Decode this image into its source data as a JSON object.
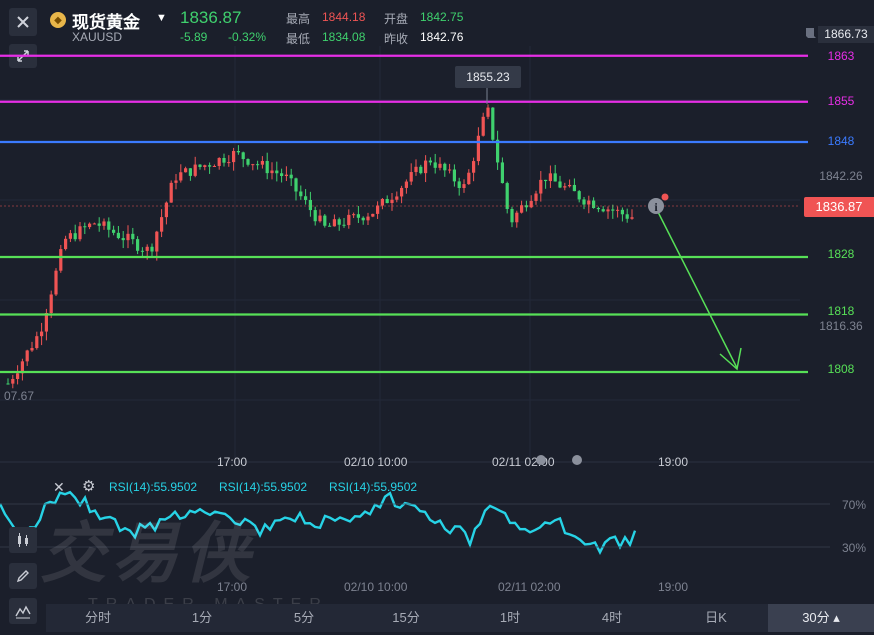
{
  "header": {
    "name": "现货黄金",
    "code": "XAUUSD",
    "price": "1836.87",
    "change": "-5.89",
    "change_pct": "-0.32%",
    "high_label": "最高",
    "high_value": "1844.18",
    "open_label": "开盘",
    "open_value": "1842.75",
    "low_label": "最低",
    "low_value": "1834.08",
    "prev_close_label": "昨收",
    "prev_close_value": "1842.76"
  },
  "price_axis": {
    "top_value": "1866.73",
    "mid_value": "1842.26",
    "current_price": "1836.87",
    "left_clip": "07.67",
    "lower_value": "1816.36"
  },
  "levels": [
    {
      "value": "1863",
      "color": "#e62ee6"
    },
    {
      "value": "1855",
      "color": "#e62ee6"
    },
    {
      "value": "1848",
      "color": "#3b7bff"
    },
    {
      "value": "1828",
      "color": "#57e057"
    },
    {
      "value": "1818",
      "color": "#57e057"
    },
    {
      "value": "1808",
      "color": "#57e057"
    }
  ],
  "tooltip": "1855.23",
  "time_axis": [
    "17:00",
    "02/10 10:00",
    "02/11 02:00",
    "19:00"
  ],
  "rsi": {
    "labels": [
      "RSI(14):55.9502",
      "RSI(14):55.9502",
      "RSI(14):55.9502"
    ],
    "levels": [
      "70%",
      "30%"
    ],
    "color": "#27d3e6"
  },
  "sub_time_axis": [
    "17:00",
    "02/10 10:00",
    "02/11 02:00",
    "19:00"
  ],
  "watermark": {
    "main": "交易侠",
    "sub": "TRADER MASTER"
  },
  "timeframes": [
    {
      "label": "分时",
      "active": false
    },
    {
      "label": "1分",
      "active": false
    },
    {
      "label": "5分",
      "active": false
    },
    {
      "label": "15分",
      "active": false
    },
    {
      "label": "1时",
      "active": false
    },
    {
      "label": "4时",
      "active": false
    },
    {
      "label": "日K",
      "active": false
    },
    {
      "label": "30分 ▴",
      "active": true
    }
  ],
  "colors": {
    "up": "#f05454",
    "down": "#3fd16e",
    "bg": "#1b1f2b"
  }
}
